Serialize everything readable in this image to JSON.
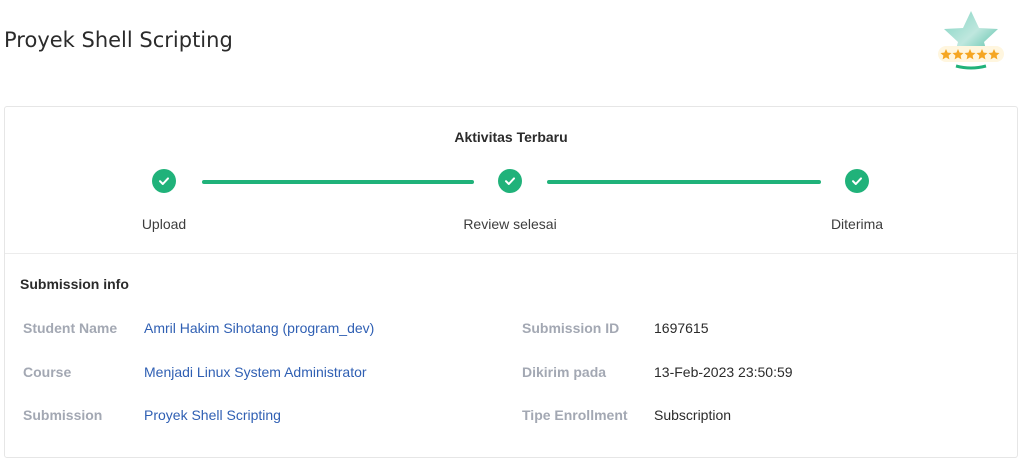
{
  "page": {
    "title": "Proyek Shell Scripting"
  },
  "activity": {
    "title": "Aktivitas Terbaru",
    "steps": [
      {
        "label": "Upload",
        "completed": true
      },
      {
        "label": "Review selesai",
        "completed": true
      },
      {
        "label": "Diterima",
        "completed": true
      }
    ]
  },
  "submission": {
    "title": "Submission info",
    "left": [
      {
        "label": "Student Name",
        "value": "Amril Hakim Sihotang (program_dev)"
      },
      {
        "label": "Course",
        "value": "Menjadi Linux System Administrator"
      },
      {
        "label": "Submission",
        "value": "Proyek Shell Scripting"
      }
    ],
    "right": [
      {
        "label": "Submission ID",
        "value": "1697615"
      },
      {
        "label": "Dikirim pada",
        "value": "13-Feb-2023 23:50:59"
      },
      {
        "label": "Tipe Enrollment",
        "value": "Subscription"
      }
    ]
  },
  "colors": {
    "accent": "#20b27a",
    "link": "#2f5fb3",
    "label": "#a3a8b3"
  },
  "icons": {
    "badge": "star-rating-badge-icon",
    "step": "check-icon"
  }
}
